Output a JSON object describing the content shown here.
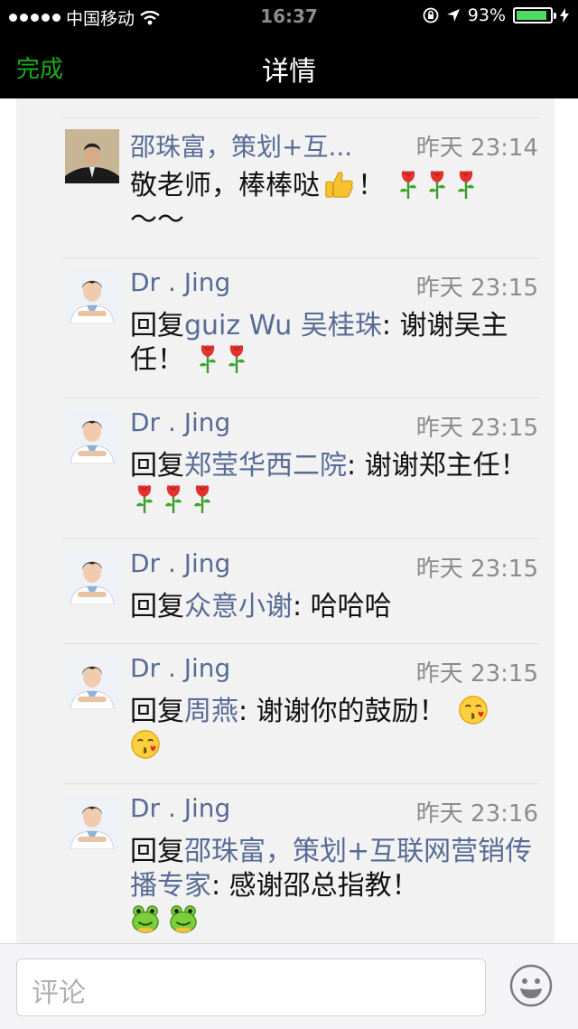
{
  "status_bar": {
    "carrier": "中国移动",
    "time": "16:37",
    "battery_pct": "93%",
    "battery_level": 0.93
  },
  "nav": {
    "done": "完成",
    "title": "详情"
  },
  "comments": [
    {
      "name": "邵珠富，策划+互...",
      "time": "昨天 23:14",
      "text": "敬老师，棒棒哒",
      "suffix": "～～"
    },
    {
      "name": "Dr . Jing",
      "time": "昨天 23:15",
      "reply_label": "回复",
      "reply_to": "guiz Wu 吴桂珠",
      "text": ": 谢谢吴主任！"
    },
    {
      "name": "Dr . Jing",
      "time": "昨天 23:15",
      "reply_label": "回复",
      "reply_to": "郑莹华西二院",
      "text": ": 谢谢郑主任！"
    },
    {
      "name": "Dr . Jing",
      "time": "昨天 23:15",
      "reply_label": "回复",
      "reply_to": "众意小谢",
      "text": ": 哈哈哈"
    },
    {
      "name": "Dr . Jing",
      "time": "昨天 23:15",
      "reply_label": "回复",
      "reply_to": "周燕",
      "text": ": 谢谢你的鼓励！"
    },
    {
      "name": "Dr . Jing",
      "time": "昨天 23:16",
      "reply_label": "回复",
      "reply_to": "邵珠富，策划+互联网营销传播专家",
      "text": ": 感谢邵总指教！"
    }
  ],
  "input": {
    "placeholder": "评论"
  },
  "colors": {
    "accent": "#1aad19",
    "link": "#576b95",
    "battery": "#4cd964"
  }
}
